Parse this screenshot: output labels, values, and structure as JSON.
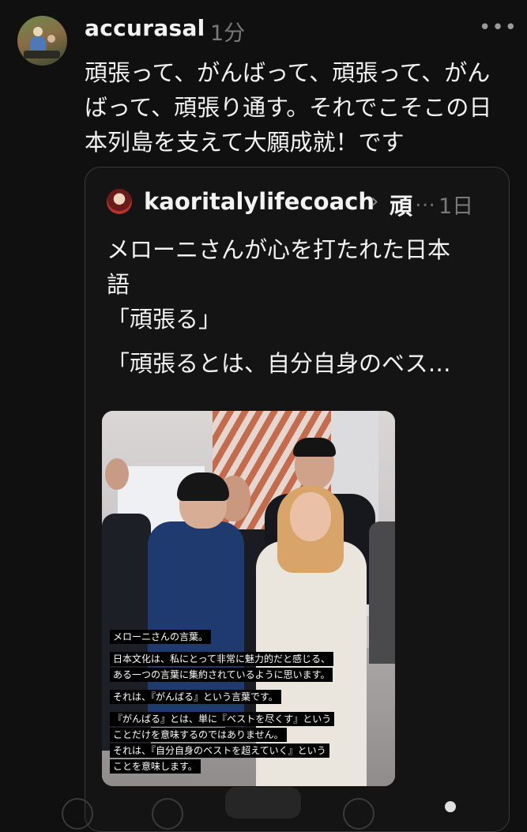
{
  "post": {
    "username": "accurasal",
    "timestamp": "1分",
    "more_label": "•••",
    "text": "頑張って、がんばって、頑張って、がんばって、頑張り通す。それでこそこの日本列島を支えて大願成就！です"
  },
  "quote": {
    "username": "kaoritalylifecoach",
    "chevron": "›",
    "topic": "頑",
    "ellipsis": "…",
    "timestamp": "1日",
    "lines": [
      "メローニさんが心を打たれた日本",
      "語",
      "「頑張る」",
      "「頑張るとは、自分自身のベス…"
    ]
  },
  "media": {
    "captions": [
      [
        "メローニさんの言葉。"
      ],
      [
        "日本文化は、私にとって非常に魅力的だと感じる、",
        "ある一つの言葉に集約されているように思います。"
      ],
      [
        "それは、『がんばる』という言葉です。"
      ],
      [
        "『がんばる』とは、単に『ベストを尽くす』という",
        "ことだけを意味するのではありません。",
        "それは、『自分自身のベストを超えていく』という",
        "ことを意味します。"
      ]
    ]
  }
}
